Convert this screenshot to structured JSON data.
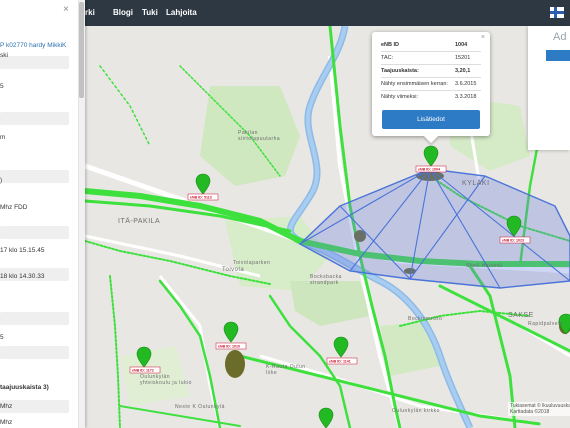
{
  "navbar": {
    "items": [
      "rki",
      "Blogi",
      "Tuki",
      "Lahjoita"
    ]
  },
  "sidebar": {
    "close_symbol": "×",
    "rows": [
      "P k02770 hardy MikkiK",
      "ski",
      "5",
      "m",
      ")",
      "Mhz FDD",
      "17 klo 15.15.45",
      "18 klo 14.30.33",
      "5",
      "taajuuskaista 3)",
      "Mhz",
      "Mhz"
    ]
  },
  "map": {
    "labels": {
      "ita_pakila": "ITÄ-PAKILA",
      "toivola": "Toivola",
      "pakilan_park": "Pakilan\nsiirtolapuutarha",
      "kyrkaki": "KYLÄKI",
      "saksela": "SAKSE",
      "tovolapark": "Toivolaparken",
      "bocksback": "Bocksbacka\nstrandpark",
      "kauppa": "K-Rauta Oulun\nliike",
      "school": "Oulunkylän\nyhteiskoulu ja lukio",
      "neste": "Neste K Oulunkylä",
      "shell": "Shell Helsinki",
      "bockinpuisto": "Bockinpuisto",
      "oulun_kirkko": "Oulunkylän kirkko",
      "rapidpalvelu": "Rapidpalvelu"
    },
    "attribution": "Tukiasemat © lkuuluvuuskartta\nKarttadata ©2018",
    "pins": [
      {
        "label": "eNB ID: 5113"
      },
      {
        "label": "eNB ID: 1004"
      },
      {
        "label": "eNB ID: 1023"
      },
      {
        "label": "eNB ID: 1172"
      },
      {
        "label": "eNB ID: 1010"
      },
      {
        "label": "eNB ID: 1141"
      },
      {
        "label": "eNB ID: 1019"
      }
    ]
  },
  "popup": {
    "rows": [
      {
        "key": "eNB ID",
        "value": "1004",
        "bold": true
      },
      {
        "key": "TAC:",
        "value": "15201",
        "bold": false
      },
      {
        "key": "Taajuuskaista:",
        "value": "3,20,1",
        "bold": true
      },
      {
        "key": "Nähty ensimmäisen kerran:",
        "value": "3.6.2015",
        "bold": false
      },
      {
        "key": "Nähty viimeksi:",
        "value": "3.3.2018",
        "bold": false
      }
    ],
    "button_label": "Lisätiedot",
    "close": "×"
  },
  "right_widget": {
    "text": "Ad"
  },
  "colors": {
    "navbar": "#2e3842",
    "accent": "#2d7bc4",
    "coverage": "#3de03d",
    "polygon": "#4a74d8",
    "river": "#7fb3e6",
    "pin": "#22b922"
  }
}
